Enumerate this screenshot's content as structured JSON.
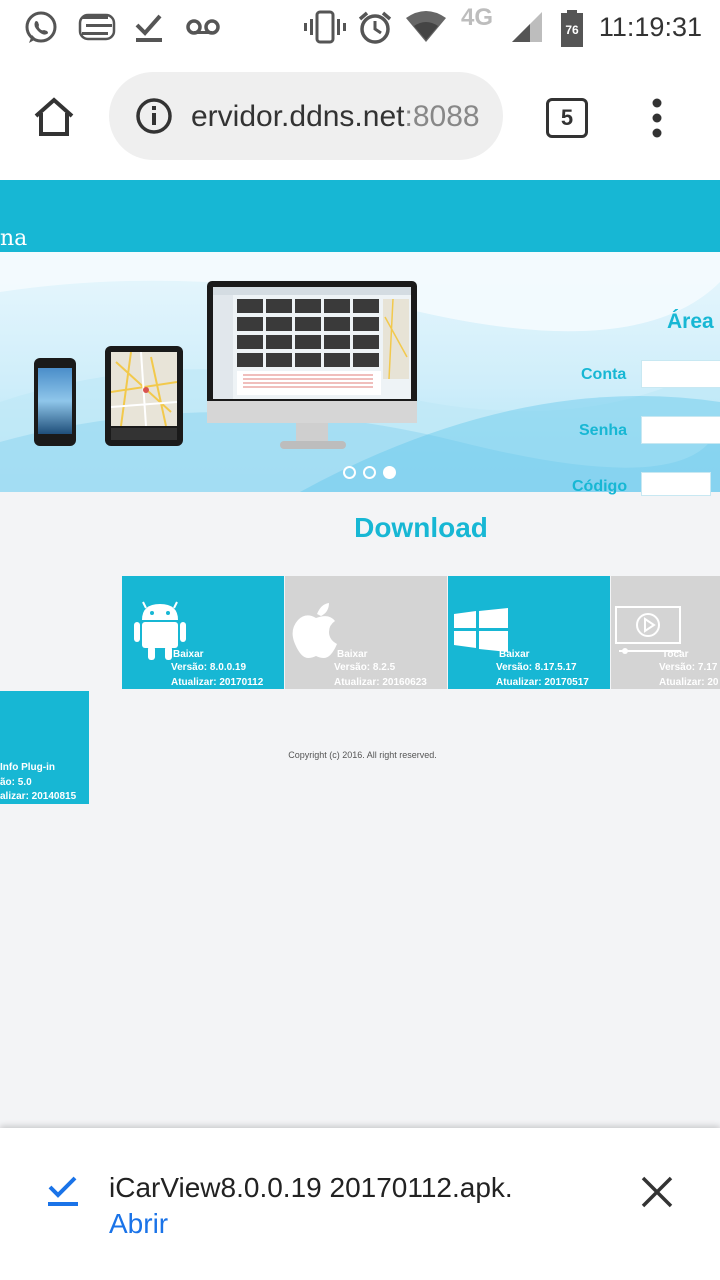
{
  "status_bar": {
    "time": "11:19:31",
    "network": "4G",
    "battery": "76",
    "icons": [
      "whatsapp-icon",
      "notification-stack-icon",
      "download-done-icon",
      "voicemail-icon",
      "vibrate-icon",
      "alarm-icon",
      "wifi-icon",
      "signal-icon",
      "battery-icon"
    ]
  },
  "browser": {
    "url_host": "ervidor.ddns.net",
    "url_port": ":8088",
    "tab_count": "5",
    "icons": [
      "home-icon",
      "info-icon",
      "tab-switcher-icon",
      "overflow-menu-icon"
    ]
  },
  "site": {
    "header_title": "na",
    "carousel_dots": 3,
    "carousel_active": 3,
    "login": {
      "heading": "Área",
      "account_label": "Conta",
      "password_label": "Senha",
      "code_label": "Código"
    },
    "download_title": "Download",
    "tiles": [
      {
        "platform": "android-icon",
        "action": "Baixar",
        "version": "Versão: 8.0.0.19",
        "updated": "Atualizar: 20170112",
        "color": "#17b7d4"
      },
      {
        "platform": "apple-icon",
        "action": "Baixar",
        "version": "Versão: 8.2.5",
        "updated": "Atualizar: 20160623",
        "color": "#d4d4d4"
      },
      {
        "platform": "windows-icon",
        "action": "Baixar",
        "version": "Versão: 8.17.5.17",
        "updated": "Atualizar: 20170517",
        "color": "#17b7d4"
      },
      {
        "platform": "video-player-icon",
        "action": "Tocar",
        "version": "Versão: 7.17",
        "updated": "Atualizar: 20",
        "color": "#d4d4d4"
      },
      {
        "platform": "plugin",
        "action": "Info Plug-in",
        "version": "ão: 5.0",
        "updated": "alizar: 20140815",
        "color": "#17b7d4"
      }
    ],
    "copyright": "Copyright (c) 2016. All right reserved."
  },
  "download_notification": {
    "filename": "iCarView8.0.0.19 20170112.apk.",
    "open_label": "Abrir",
    "icons": [
      "download-complete-icon",
      "close-icon"
    ]
  },
  "colors": {
    "brand": "#17b7d4",
    "tile_gray": "#d4d4d4",
    "link_blue": "#1a73e8"
  }
}
